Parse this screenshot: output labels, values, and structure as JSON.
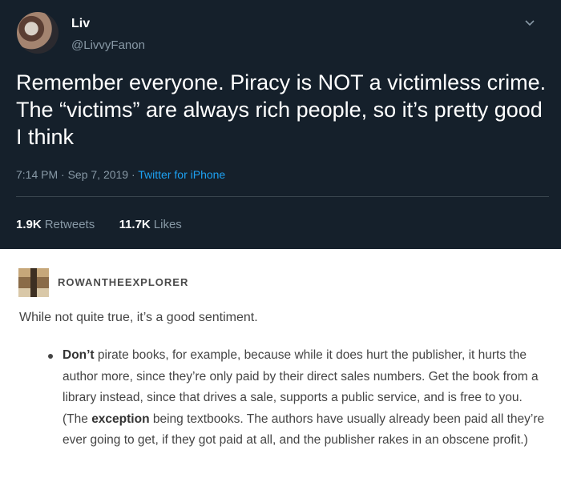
{
  "tweet": {
    "display_name": "Liv",
    "handle": "@LivvyFanon",
    "text": "Remember everyone. Piracy is NOT a victimless crime. The “victims” are always rich people, so it’s pretty good I think",
    "time": "7:14 PM · Sep 7, 2019 · ",
    "source": "Twitter for iPhone",
    "retweets_count": "1.9K",
    "retweets_label": "Retweets",
    "likes_count": "11.7K",
    "likes_label": "Likes",
    "bg_color": "#15202b",
    "link_color": "#1da1f2"
  },
  "post": {
    "username": "ROWANTHEEXPLORER",
    "intro": "While not quite true, it’s a good sentiment.",
    "bullet": {
      "part1_bold": "Don’t",
      "part2": " pirate books, for example, because while it does hurt the publisher, it hurts the author more, since they’re only paid by their direct sales numbers. Get the book from a library instead, since that drives a sale, supports a public service, and is free to you. (The ",
      "part3_bold": "exception",
      "part4": " being textbooks. The authors have usually already been paid all they’re ever going to get, if they got paid at all, and the publisher rakes in an obscene profit.)"
    }
  },
  "icons": {
    "chevron": "chevron-down-icon"
  }
}
